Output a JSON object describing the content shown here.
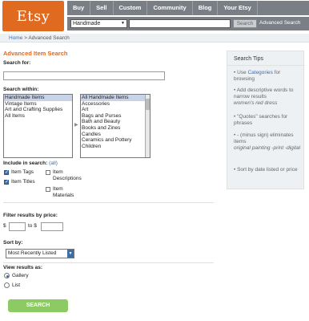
{
  "header": {
    "logo": "Etsy",
    "nav": [
      "Buy",
      "Sell",
      "Custom",
      "Community",
      "Blog",
      "Your Etsy"
    ],
    "category_value": "Handmade",
    "search_button": "Search",
    "advanced_link": "Advanced Search"
  },
  "breadcrumb": {
    "home": "Home",
    "separator": ">",
    "current": "Advanced Search"
  },
  "form": {
    "title": "Advanced Item Search",
    "search_for_label": "Search for:",
    "search_for_value": "",
    "search_within_label": "Search within:",
    "within_options": [
      "Handmade Items",
      "Vintage Items",
      "Art and Crafting Supplies",
      "All Items"
    ],
    "category_options": [
      "All Handmade Items",
      "Accessories",
      "Art",
      "Bags and Purses",
      "Bath and Beauty",
      "Books and Zines",
      "Candles",
      "Ceramics and Pottery",
      "Children"
    ],
    "include_label": "Include in search:",
    "include_all_link": "(all)",
    "checkboxes": [
      {
        "label": "Item Tags",
        "checked": true
      },
      {
        "label": "Item Titles",
        "checked": true
      },
      {
        "label": "Item Descriptions",
        "checked": false
      },
      {
        "label": "Item Materials",
        "checked": false
      }
    ],
    "price_label": "Filter results by price:",
    "price_from_prefix": "$",
    "price_to_text": "to $",
    "sort_label": "Sort by:",
    "sort_value": "Most Recently Listed",
    "view_label": "View results as:",
    "view_options": [
      {
        "label": "Gallery",
        "selected": true
      },
      {
        "label": "List",
        "selected": false
      }
    ],
    "submit": "SEARCH"
  },
  "tips": {
    "title": "Search Tips",
    "items": [
      {
        "pre": "• Use ",
        "link": "Categories",
        "post": " for browsing",
        "example": ""
      },
      {
        "pre": "• Add descriptive words to narrow results",
        "link": "",
        "post": "",
        "example": "women's red dress"
      },
      {
        "pre": "• \"Quotes\" searches for phrases",
        "link": "",
        "post": "",
        "example": ""
      },
      {
        "pre": "• - (minus sign) eliminates items",
        "link": "",
        "post": "",
        "example": "original painting -print -digital"
      },
      {
        "pre": "• Sort by date listed or price",
        "link": "",
        "post": "",
        "example": ""
      }
    ]
  },
  "colors": {
    "accent": "#e06a1f",
    "nav_bg": "#7a7f86",
    "link": "#3c6ea9",
    "button": "#8ccb64"
  }
}
